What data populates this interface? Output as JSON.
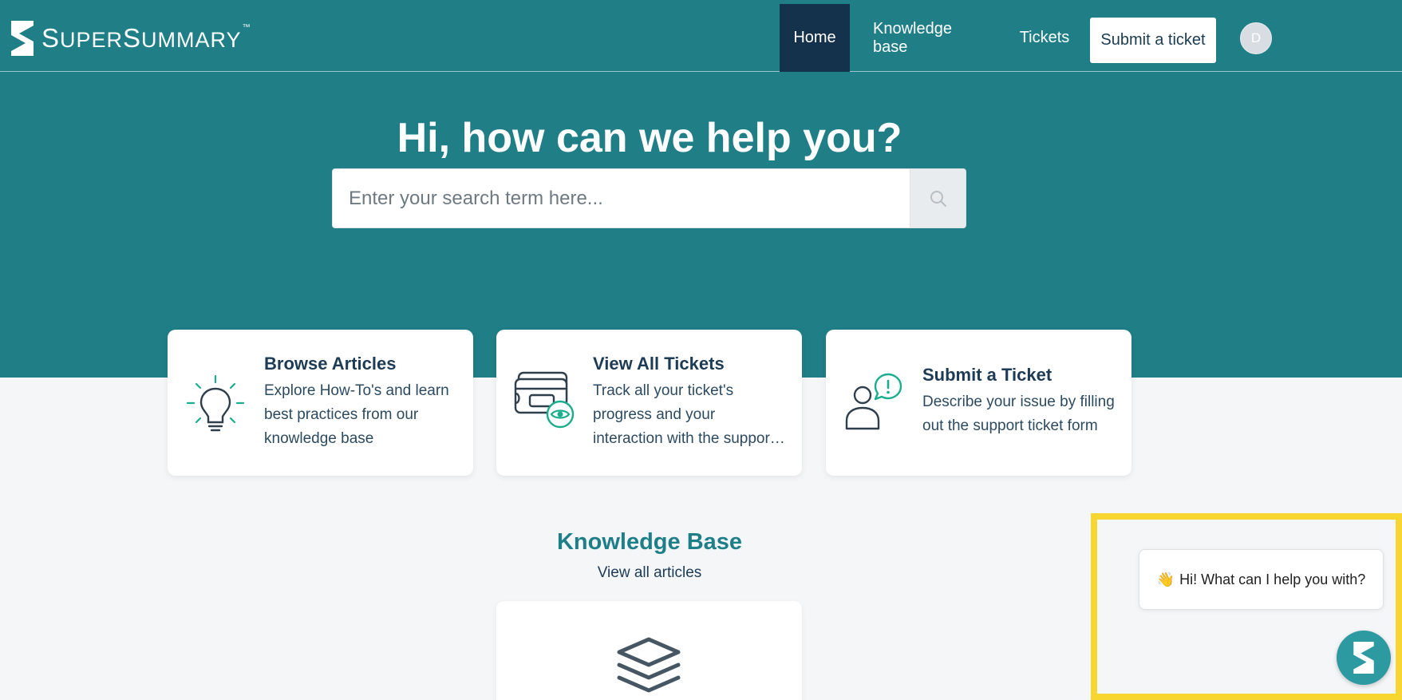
{
  "brand": {
    "name_first": "S",
    "name_rest1": "UPER",
    "name_second": "S",
    "name_rest2": "UMMARY",
    "tm": "™"
  },
  "nav": {
    "home": "Home",
    "knowledge_base": "Knowledge base",
    "tickets": "Tickets",
    "submit": "Submit a ticket",
    "avatar_initial": "D"
  },
  "hero": {
    "title": "Hi, how can we help you?",
    "search_placeholder": "Enter your search term here..."
  },
  "cards": [
    {
      "title": "Browse Articles",
      "desc": "Explore How-To's and learn best practices from our knowledge base",
      "icon": "lightbulb-icon"
    },
    {
      "title": "View All Tickets",
      "desc_line1": "Track all your ticket's",
      "desc_line2": "progress and your",
      "desc_line3": "interaction with the support team",
      "icon": "tickets-eye-icon"
    },
    {
      "title": "Submit a Ticket",
      "desc": "Describe your issue by filling out the support ticket form",
      "icon": "person-alert-icon"
    }
  ],
  "knowledge_base": {
    "title": "Knowledge Base",
    "subtitle": "View all articles",
    "icon": "layers-icon"
  },
  "chat": {
    "wave": "👋",
    "message": "Hi! What can I help you with?"
  },
  "colors": {
    "hero": "#207e87",
    "nav_active": "#15324d",
    "accent": "#1f7f89",
    "icon_green": "#1aae8e",
    "highlight": "#f7d632"
  }
}
